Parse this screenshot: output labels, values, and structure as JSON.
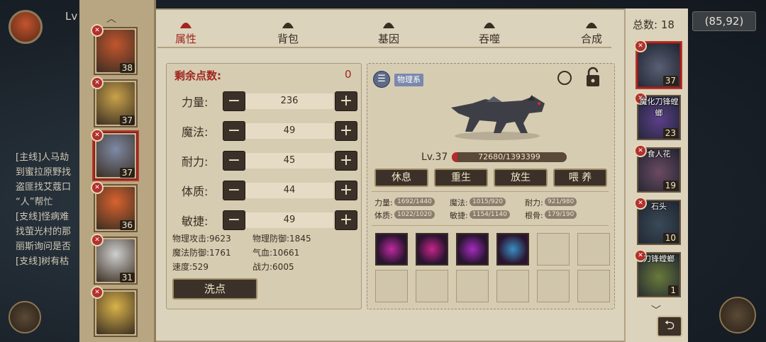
{
  "background": {
    "player_level_label": "Lv",
    "coords": "(85,92)",
    "quest_lines": [
      "[主线]人马劫",
      "到蜜拉原野找",
      "盗匪找艾蔻口",
      "“人”帮忙",
      "[支线]怪病难",
      "找萤光村的那",
      "丽斯询问是否",
      "[支线]树有枯"
    ]
  },
  "roster": {
    "cards": [
      {
        "level": "38",
        "color": "#c2552e",
        "selected": false
      },
      {
        "level": "37",
        "color": "#c9a24a",
        "selected": false
      },
      {
        "level": "37",
        "color": "#7e8aa6",
        "selected": true
      },
      {
        "level": "36",
        "color": "#d8622f",
        "selected": false
      },
      {
        "level": "31",
        "color": "#cfcfcf",
        "selected": false
      },
      {
        "level": "",
        "color": "#d9b24a",
        "selected": false
      }
    ]
  },
  "tabs": [
    {
      "label": "属性",
      "icon": "flame-icon",
      "active": true
    },
    {
      "label": "背包",
      "icon": "bag-icon",
      "active": false
    },
    {
      "label": "基因",
      "icon": "gene-icon",
      "active": false
    },
    {
      "label": "吞噬",
      "icon": "devour-icon",
      "active": false
    },
    {
      "label": "合成",
      "icon": "synthesis-icon",
      "active": false
    }
  ],
  "stats": {
    "points_label": "剩余点数:",
    "points_value": "0",
    "rows": [
      {
        "name": "力量:",
        "value": "236"
      },
      {
        "name": "魔法:",
        "value": "49"
      },
      {
        "name": "耐力:",
        "value": "45"
      },
      {
        "name": "体质:",
        "value": "44"
      },
      {
        "name": "敏捷:",
        "value": "49"
      }
    ],
    "minus_label": "−",
    "plus_label": "+",
    "derived": [
      {
        "label": "物理攻击:",
        "value": "9623"
      },
      {
        "label": "物理防御:",
        "value": "1845"
      },
      {
        "label": "魔法防御:",
        "value": "1761"
      },
      {
        "label": "气血:",
        "value": "10661"
      },
      {
        "label": "速度:",
        "value": "529"
      },
      {
        "label": "战力:",
        "value": "6005"
      }
    ],
    "reset_label": "洗点"
  },
  "pet": {
    "type_tag": "物理系",
    "level": "Lv.37",
    "exp_text": "72680/1393399",
    "exp_fraction": 0.052,
    "actions": [
      "休息",
      "重生",
      "放生",
      "喂 养"
    ],
    "attrs": [
      {
        "label": "力量:",
        "value": "1692/1440"
      },
      {
        "label": "魔法:",
        "value": "1015/920"
      },
      {
        "label": "耐力:",
        "value": "921/980"
      },
      {
        "label": "体质:",
        "value": "1022/1020"
      },
      {
        "label": "敏捷:",
        "value": "1154/1140"
      },
      {
        "label": "根骨:",
        "value": "179/190"
      }
    ],
    "skills": [
      {
        "name": "skill-vortex-icon",
        "color": "#c02aa0"
      },
      {
        "name": "skill-claw-icon",
        "color": "#c8248a"
      },
      {
        "name": "skill-burst-icon",
        "color": "#a42cc0"
      },
      {
        "name": "skill-frost-icon",
        "color": "#3a8fc4"
      }
    ]
  },
  "right": {
    "total_label": "总数: 18",
    "cards": [
      {
        "name": "",
        "level": "37",
        "color": "#5a5f74",
        "selected": true
      },
      {
        "name": "魔化刀锋螳螂",
        "level": "23",
        "color": "#5c3f8a",
        "selected": false
      },
      {
        "name": "食人花",
        "level": "19",
        "color": "#6c4a62",
        "selected": false
      },
      {
        "name": "石头",
        "level": "10",
        "color": "#3a4a58",
        "selected": false
      },
      {
        "name": "刀锋螳螂",
        "level": "1",
        "color": "#6a7a3a",
        "selected": false
      }
    ]
  }
}
